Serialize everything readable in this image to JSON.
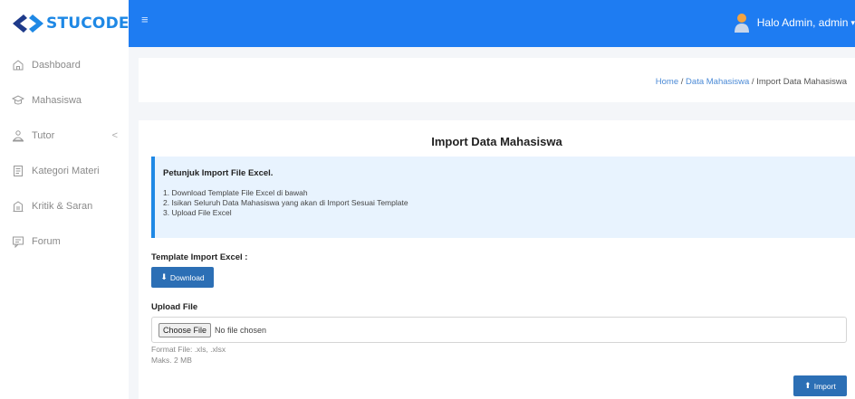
{
  "brand": {
    "name": "STUCODE"
  },
  "sidebar": {
    "items": [
      {
        "label": "Dashboard",
        "icon": "home-icon"
      },
      {
        "label": "Mahasiswa",
        "icon": "students-icon"
      },
      {
        "label": "Tutor",
        "icon": "tutor-icon",
        "chevron": "<"
      },
      {
        "label": "Kategori Materi",
        "icon": "category-icon"
      },
      {
        "label": "Kritik & Saran",
        "icon": "feedback-icon"
      },
      {
        "label": "Forum",
        "icon": "forum-icon"
      }
    ]
  },
  "topbar": {
    "menu_icon": "≡",
    "user_greeting": "Halo Admin, admin",
    "dropdown_icon": "chevron-down-icon"
  },
  "breadcrumb": {
    "home": "Home",
    "sep1": " / ",
    "section": "Data Mahasiswa",
    "sep2": " / ",
    "current": "Import Data Mahasiswa"
  },
  "card": {
    "title": "Import Data Mahasiswa",
    "callout_title": "Petunjuk Import File Excel.",
    "steps": [
      "1. Download Template File Excel di bawah",
      "2. Isikan Seluruh Data Mahasiswa yang akan di Import Sesuai Template",
      "3. Upload File Excel"
    ],
    "template_label": "Template Import Excel :",
    "download_label": "Download",
    "upload_label": "Upload File",
    "choose_file_label": "Choose File",
    "no_file_text": "No file chosen",
    "format_text": "Format File: .xls, .xlsx",
    "max_size_text": "Maks. 2 MB",
    "import_label": "Import"
  },
  "colors": {
    "topbar": "#1e7cf2",
    "brand": "#1e88e5",
    "button": "#2c6fb5",
    "callout_bg": "#e8f3fe"
  }
}
